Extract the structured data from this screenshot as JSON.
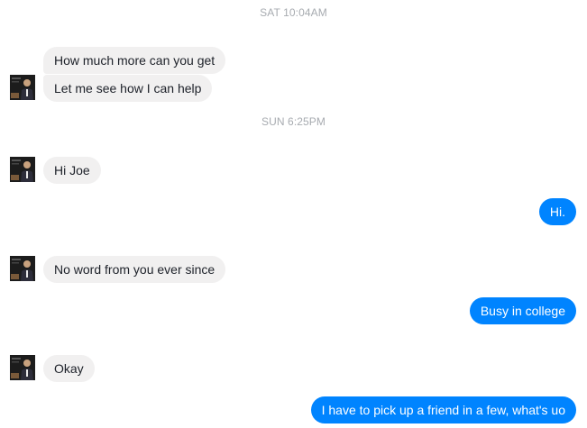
{
  "conversation": {
    "timestamps": [
      "SAT 10:04AM",
      "SUN 6:25PM"
    ],
    "messages": [
      {
        "from": "them",
        "text": "How much more can you get"
      },
      {
        "from": "them",
        "text": "Let me see how I can help"
      },
      {
        "from": "them",
        "text": "Hi Joe"
      },
      {
        "from": "me",
        "text": "Hi."
      },
      {
        "from": "them",
        "text": "No word from you ever since"
      },
      {
        "from": "me",
        "text": "Busy in college"
      },
      {
        "from": "them",
        "text": "Okay"
      },
      {
        "from": "me",
        "text": "I have to pick up a friend in a few, what's uo"
      }
    ]
  },
  "colors": {
    "outgoing_bubble": "#0084ff",
    "incoming_bubble": "#f1f0f0",
    "timestamp": "#a7abb0"
  },
  "avatar_icon": "contact-avatar-icon"
}
